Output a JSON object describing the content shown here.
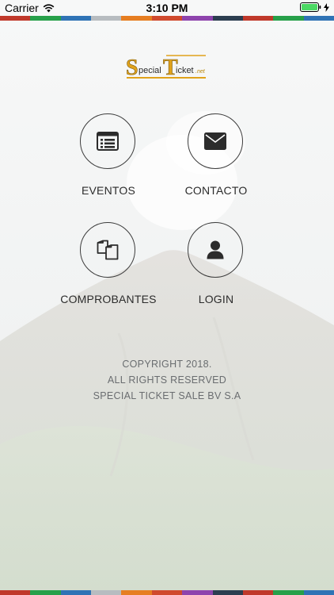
{
  "status_bar": {
    "carrier": "Carrier",
    "time": "3:10 PM",
    "wifi_icon": "wifi-icon",
    "battery_icon": "battery-icon",
    "charging_icon": "bolt-icon"
  },
  "stripe_colors": [
    "#c0392b",
    "#27a04a",
    "#2f73b5",
    "#b7bcc0",
    "#e67e22",
    "#d04a2e",
    "#8e44ad",
    "#2c3e50",
    "#c0392b",
    "#27a04a",
    "#2f73b5"
  ],
  "logo": {
    "text_special": "pecial",
    "text_ticket": "icket",
    "text_domain": ".net",
    "letter_s": "S",
    "letter_t": "T"
  },
  "menu": {
    "eventos": {
      "label": "EVENTOS",
      "icon": "list-icon"
    },
    "contacto": {
      "label": "CONTACTO",
      "icon": "envelope-icon"
    },
    "comprobantes": {
      "label": "COMPROBANTES",
      "icon": "documents-icon"
    },
    "login": {
      "label": "LOGIN",
      "icon": "user-icon"
    }
  },
  "footer": {
    "line1": "COPYRIGHT 2018.",
    "line2": "ALL RIGHTS RESERVED",
    "line3": "SPECIAL TICKET SALE BV S.A"
  },
  "colors": {
    "accent_gold": "#e0a21b",
    "icon_dark": "#2c2c2c",
    "text_dark": "#2c2c2c",
    "text_muted": "#6a6d70"
  }
}
